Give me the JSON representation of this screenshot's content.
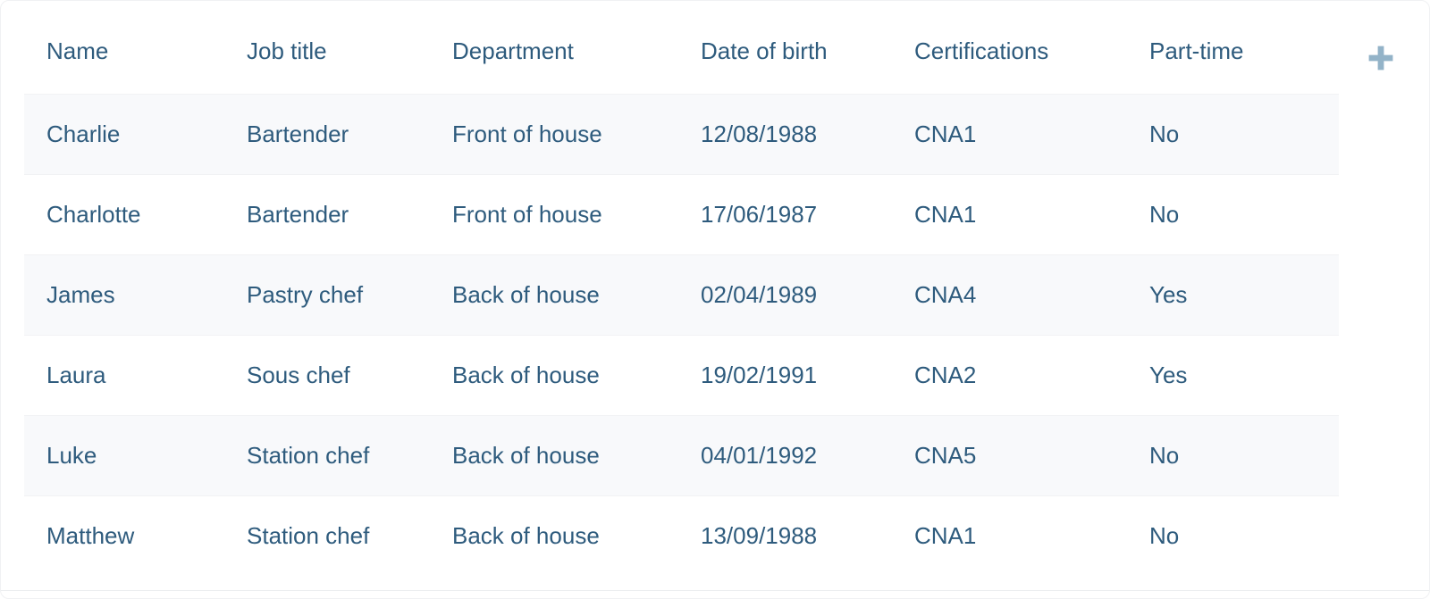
{
  "table": {
    "columns": [
      {
        "key": "name",
        "label": "Name"
      },
      {
        "key": "job",
        "label": "Job title"
      },
      {
        "key": "dept",
        "label": "Department"
      },
      {
        "key": "dob",
        "label": "Date of birth"
      },
      {
        "key": "cert",
        "label": "Certifications"
      },
      {
        "key": "part",
        "label": "Part-time"
      }
    ],
    "rows": [
      {
        "name": "Charlie",
        "job": "Bartender",
        "dept": "Front of house",
        "dob": "12/08/1988",
        "cert": "CNA1",
        "part": "No"
      },
      {
        "name": "Charlotte",
        "job": "Bartender",
        "dept": "Front of house",
        "dob": "17/06/1987",
        "cert": "CNA1",
        "part": "No"
      },
      {
        "name": "James",
        "job": "Pastry chef",
        "dept": "Back of house",
        "dob": "02/04/1989",
        "cert": "CNA4",
        "part": "Yes"
      },
      {
        "name": "Laura",
        "job": "Sous chef",
        "dept": "Back of house",
        "dob": "19/02/1991",
        "cert": "CNA2",
        "part": "Yes"
      },
      {
        "name": "Luke",
        "job": "Station chef",
        "dept": "Back of house",
        "dob": "04/01/1992",
        "cert": "CNA5",
        "part": "No"
      },
      {
        "name": "Matthew",
        "job": "Station chef",
        "dept": "Back of house",
        "dob": "13/09/1988",
        "cert": "CNA1",
        "part": "No"
      }
    ],
    "add_column": {
      "icon": "plus-icon"
    }
  },
  "colors": {
    "text": "#2e5b7d",
    "row_stripe": "#f8f9fb",
    "row_plain": "#ffffff",
    "row_divider": "#f1f2f4",
    "add_icon": "#93b3c8",
    "page_background": "#ffffff"
  }
}
